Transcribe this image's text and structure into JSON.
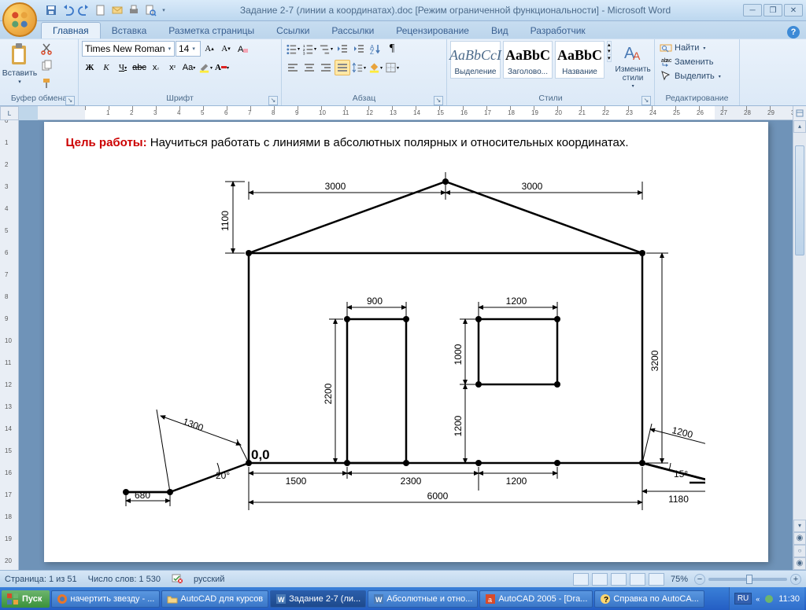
{
  "title": "Задание 2-7 (линии а координатах).doc [Режим ограниченной функциональности] - Microsoft Word",
  "tabs": {
    "home": "Главная",
    "insert": "Вставка",
    "layout": "Разметка страницы",
    "refs": "Ссылки",
    "mail": "Рассылки",
    "review": "Рецензирование",
    "view": "Вид",
    "dev": "Разработчик"
  },
  "ribbon": {
    "clipboard": {
      "paste": "Вставить",
      "label": "Буфер обмена"
    },
    "font": {
      "name": "Times New Roman",
      "size": "14",
      "label": "Шрифт"
    },
    "paragraph": {
      "label": "Абзац"
    },
    "styles": {
      "label": "Стили",
      "s1": {
        "preview": "AaBbCcI",
        "name": "Выделение",
        "italic": true
      },
      "s2": {
        "preview": "AaBbC",
        "name": "Заголово..."
      },
      "s3": {
        "preview": "AaBbC",
        "name": "Название"
      },
      "change": "Изменить стили"
    },
    "editing": {
      "label": "Редактирование",
      "find": "Найти",
      "replace": "Заменить",
      "select": "Выделить"
    }
  },
  "doc": {
    "goal_label": "Цель работы:",
    "goal_text": " Научиться работать с линиями в абсолютных полярных и относительных координатах.",
    "origin": "0,0",
    "dims": {
      "d3000a": "3000",
      "d3000b": "3000",
      "d1100": "1100",
      "d3200": "3200",
      "d900": "900",
      "d1200a": "1200",
      "d1000": "1000",
      "d2200": "2200",
      "d1200b": "1200",
      "d1300": "1300",
      "d20deg": "20°",
      "d680": "680",
      "d1500": "1500",
      "d2300": "2300",
      "d1200c": "1200",
      "d6000": "6000",
      "d1200d": "1200",
      "d15deg": "15°",
      "d1180": "1180"
    }
  },
  "status": {
    "page": "Страница: 1 из 51",
    "words": "Число слов: 1 530",
    "lang": "русский",
    "zoom": "75%"
  },
  "taskbar": {
    "start": "Пуск",
    "t1": "начертить звезду - ...",
    "t2": "AutoCAD для курсов",
    "t3": "Задание 2-7 (ли...",
    "t4": "Абсолютные и отно...",
    "t5": "AutoCAD 2005 - [Dra...",
    "t6": "Справка по AutoCA...",
    "lang": "RU",
    "time": "11:30"
  }
}
